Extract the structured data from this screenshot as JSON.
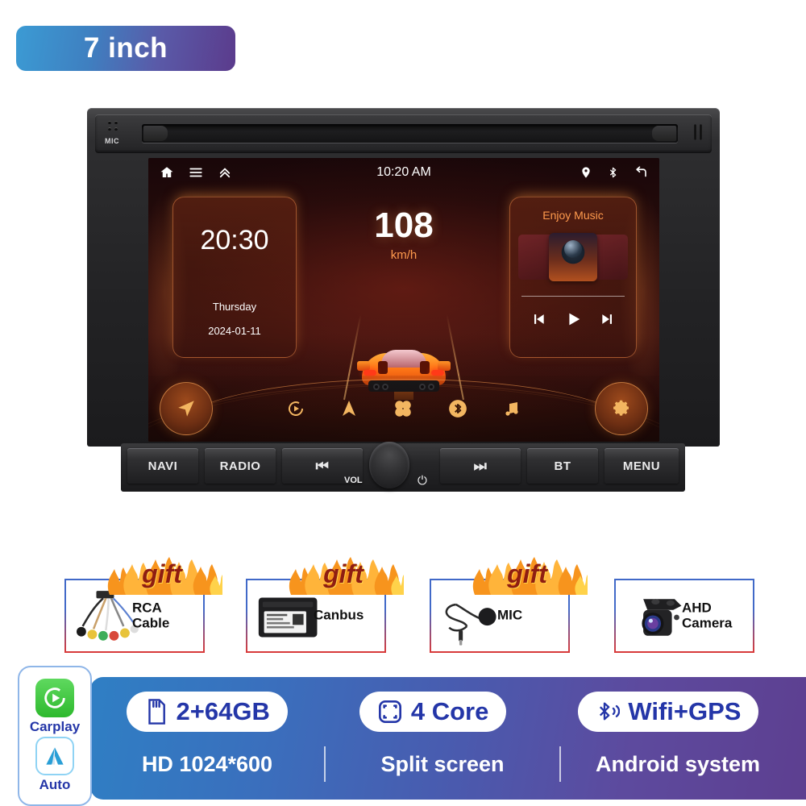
{
  "size_badge": {
    "label": "7 inch"
  },
  "head_unit": {
    "mic_label": "MIC",
    "screen": {
      "statusbar": {
        "time": "10:20 AM",
        "left_icons": [
          "home-icon",
          "menu-icon",
          "chevron-up-double-icon"
        ],
        "right_icons": [
          "location-pin-icon",
          "bluetooth-icon",
          "back-arrow-icon"
        ]
      },
      "clock_widget": {
        "time": "20:30",
        "day": "Thursday",
        "date": "2024-01-11"
      },
      "speed_widget": {
        "value": "108",
        "unit": "km/h"
      },
      "music_widget": {
        "title": "Enjoy Music",
        "controls": [
          "previous-track",
          "play",
          "next-track"
        ]
      },
      "dock": {
        "left_button": "navigation-arrow-icon",
        "right_button": "settings-gear-icon",
        "items": [
          "carplay-icon",
          "navigation-icon",
          "apps-icon",
          "bluetooth-icon",
          "music-note-icon"
        ]
      }
    },
    "buttons": {
      "navi": "NAVI",
      "radio": "RADIO",
      "prev": "⏮",
      "next": "⏭",
      "bt": "BT",
      "menu": "MENU",
      "vol": "VOL",
      "power": "⏻"
    }
  },
  "gifts": [
    {
      "label": "RCA\nCable",
      "label_line1": "RCA",
      "label_line2": "Cable",
      "gift_tag": "gift",
      "has_gift_flame": true,
      "art": "rca-cable"
    },
    {
      "label": "Canbus",
      "label_line1": "Canbus",
      "label_line2": "",
      "gift_tag": "gift",
      "has_gift_flame": true,
      "art": "canbus-box"
    },
    {
      "label": "MIC",
      "label_line1": "MIC",
      "label_line2": "",
      "gift_tag": "gift",
      "has_gift_flame": true,
      "art": "microphone"
    },
    {
      "label": "AHD\nCamera",
      "label_line1": "AHD",
      "label_line2": "Camera",
      "gift_tag": "",
      "has_gift_flame": false,
      "art": "ahd-camera"
    }
  ],
  "carplay_badge": {
    "carplay_label": "Carplay",
    "auto_label": "Auto"
  },
  "specs": {
    "pills": [
      {
        "icon": "sd-card-icon",
        "label": "2+64GB"
      },
      {
        "icon": "split-screen-icon",
        "label": "4 Core"
      },
      {
        "icon": "bluetooth-wifi-icon",
        "label": "Wifi+GPS"
      }
    ],
    "subs": [
      "HD 1024*600",
      "Split screen",
      "Android system"
    ]
  },
  "colors": {
    "badge_gradient_start": "#3b9bd4",
    "badge_gradient_end": "#5b3b8c",
    "spec_blue": "#2f7fc4",
    "spec_purple": "#5d3f90",
    "pill_text": "#2436a8",
    "screen_accent": "#ff9a4d",
    "gift_text": "#8f1d12"
  }
}
